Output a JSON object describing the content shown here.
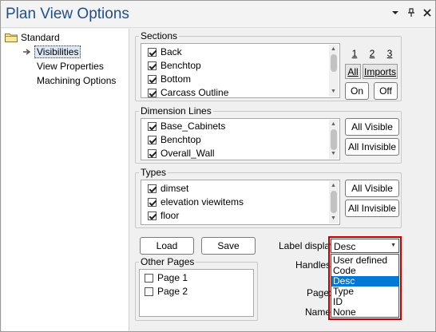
{
  "window": {
    "title": "Plan View Options"
  },
  "titlebar_icons": [
    "chevron-down-icon",
    "pin-icon",
    "close-icon"
  ],
  "tree": {
    "root": "Standard",
    "items": [
      "Visibilities",
      "View Properties",
      "Machining Options"
    ],
    "selected": "Visibilities"
  },
  "sections": {
    "label": "Sections",
    "items": [
      {
        "label": "Back",
        "checked": true
      },
      {
        "label": "Benchtop",
        "checked": true
      },
      {
        "label": "Bottom",
        "checked": true
      },
      {
        "label": "Carcass Outline",
        "checked": true
      }
    ],
    "pages": [
      "1",
      "2",
      "3"
    ],
    "tab_all": "All",
    "tab_imports": "Imports",
    "on_label": "On",
    "off_label": "Off"
  },
  "dimension_lines": {
    "label": "Dimension Lines",
    "items": [
      {
        "label": "Base_Cabinets",
        "checked": true
      },
      {
        "label": "Benchtop",
        "checked": true
      },
      {
        "label": "Overall_Wall",
        "checked": true
      }
    ],
    "all_visible": "All Visible",
    "all_invisible": "All Invisible"
  },
  "types": {
    "label": "Types",
    "items": [
      {
        "label": "dimset",
        "checked": true
      },
      {
        "label": "elevation viewitems",
        "checked": true
      },
      {
        "label": "floor",
        "checked": true
      }
    ],
    "all_visible": "All Visible",
    "all_invisible": "All Invisible"
  },
  "actions": {
    "load": "Load",
    "save": "Save"
  },
  "other_pages": {
    "label": "Other Pages",
    "items": [
      {
        "label": "Page 1",
        "checked": false
      },
      {
        "label": "Page 2",
        "checked": false
      }
    ]
  },
  "label_display": {
    "label": "Label display:",
    "value": "Desc",
    "options": [
      "User defined",
      "Code",
      "Desc",
      "Type",
      "ID",
      "None"
    ],
    "selected": "Desc"
  },
  "partial_labels": {
    "handles": "Handles:",
    "page": "Page:",
    "name": "Name:"
  }
}
